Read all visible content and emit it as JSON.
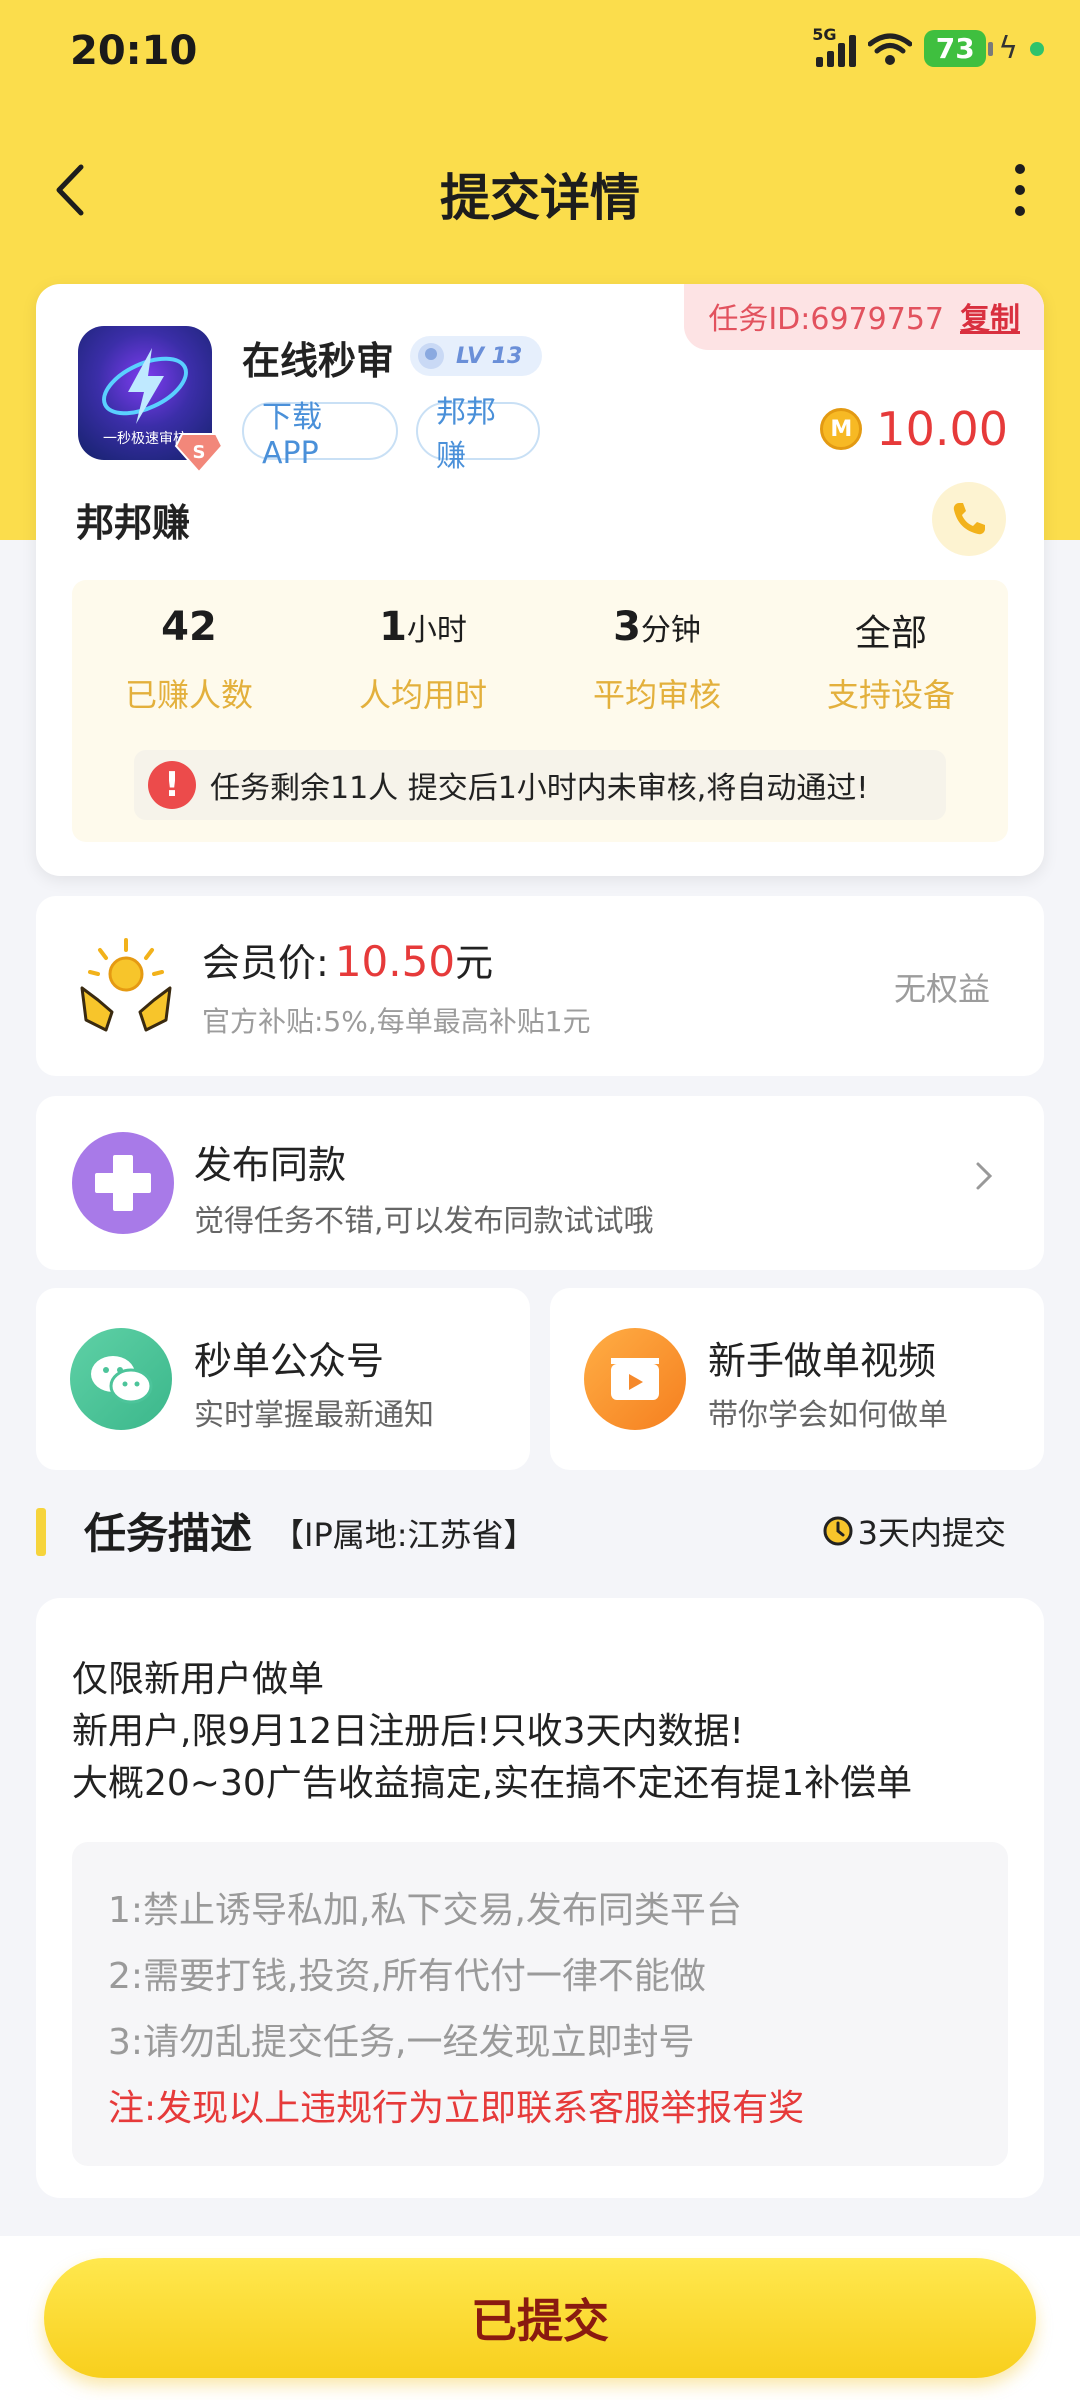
{
  "status_bar": {
    "time": "20:10",
    "network": "5G",
    "battery": "73"
  },
  "nav": {
    "title": "提交详情"
  },
  "task": {
    "id_label": "任务ID:6979757",
    "copy_label": "复制",
    "app_name": "在线秒审",
    "logo_caption": "一秒极速审核",
    "level": "LV 13",
    "tags": [
      "下载APP",
      "邦邦赚"
    ],
    "reward": "10.00",
    "coin_symbol": "M",
    "merchant": "邦邦赚",
    "stats": [
      {
        "value": "42",
        "unit": "",
        "label": "已赚人数"
      },
      {
        "value": "1",
        "unit": "小时",
        "label": "人均用时"
      },
      {
        "value": "3",
        "unit": "分钟",
        "label": "平均审核"
      },
      {
        "value": "全部",
        "unit": "",
        "label": "支持设备"
      }
    ],
    "notice": "任务剩余11人  提交后1小时内未审核,将自动通过!"
  },
  "vip": {
    "label": "会员价:",
    "price": "10.50",
    "unit": "元",
    "subtitle": "官方补贴:5%,每单最高补贴1元",
    "status": "无权益"
  },
  "publish": {
    "title": "发布同款",
    "subtitle": "觉得任务不错,可以发布同款试试哦"
  },
  "mini_cards": [
    {
      "title": "秒单公众号",
      "subtitle": "实时掌握最新通知"
    },
    {
      "title": "新手做单视频",
      "subtitle": "带你学会如何做单"
    }
  ],
  "description": {
    "title": "任务描述",
    "ip": "【IP属地:江苏省】",
    "deadline": "3天内提交",
    "lines": [
      "仅限新用户做单",
      "新用户,限9月12日注册后!只收3天内数据!",
      "大概20~30广告收益搞定,实在搞不定还有提1补偿单"
    ],
    "rules": [
      "1:禁止诱导私加,私下交易,发布同类平台",
      "2:需要打钱,投资,所有代付一律不能做",
      "3:请勿乱提交任务,一经发现立即封号"
    ],
    "warning": "注:发现以上违规行为立即联系客服举报有奖"
  },
  "bottom": {
    "submit_label": "已提交"
  },
  "colors": {
    "header_yellow": "#fbdd4c",
    "price_red": "#e63a3a",
    "stat_label_gold": "#e3b03c"
  }
}
